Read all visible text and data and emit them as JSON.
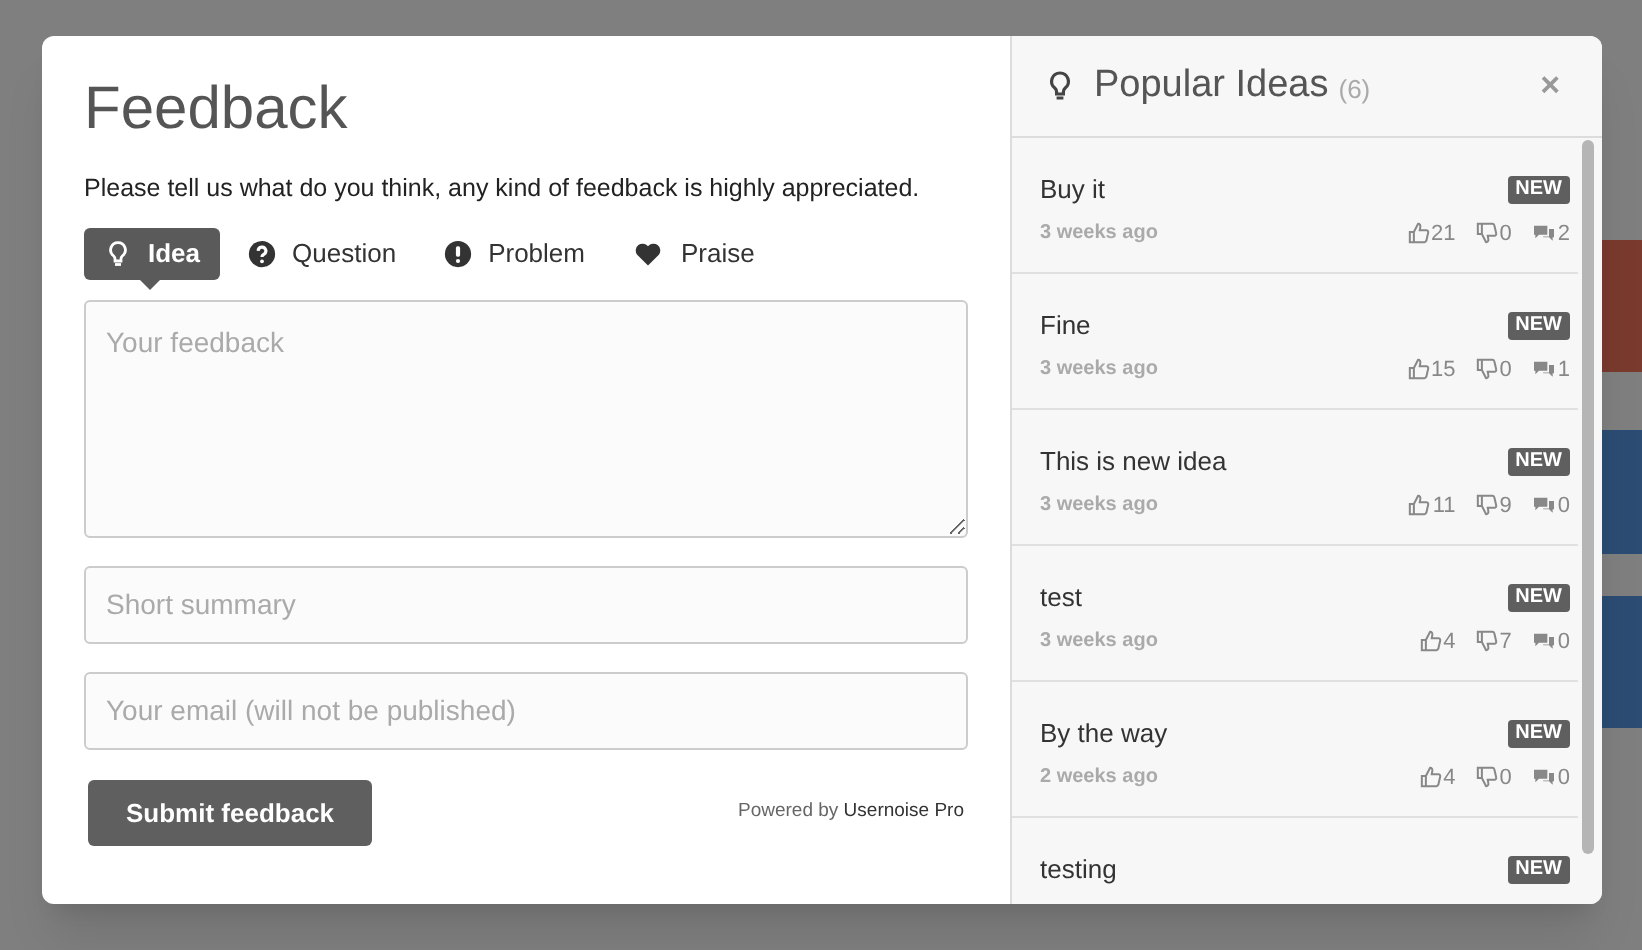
{
  "feedback": {
    "title": "Feedback",
    "intro": "Please tell us what do you think, any kind of feedback is highly appreciated.",
    "tabs": [
      {
        "label": "Idea",
        "selected": true
      },
      {
        "label": "Question",
        "selected": false
      },
      {
        "label": "Problem",
        "selected": false
      },
      {
        "label": "Praise",
        "selected": false
      }
    ],
    "feedback_field": {
      "placeholder": "Your feedback"
    },
    "summary_field": {
      "placeholder": "Short summary"
    },
    "email_field": {
      "placeholder": "Your email (will not be published)"
    },
    "submit": "Submit feedback",
    "powered_by": "Powered by",
    "powered_link": "Usernoise Pro"
  },
  "ideas": {
    "title": "Popular Ideas",
    "count": "(6)",
    "close": "×",
    "items": [
      {
        "title": "Buy it",
        "badge": "NEW",
        "time": "3 weeks ago",
        "likes": "21",
        "dislikes": "0",
        "comments": "2"
      },
      {
        "title": "Fine",
        "badge": "NEW",
        "time": "3 weeks ago",
        "likes": "15",
        "dislikes": "0",
        "comments": "1"
      },
      {
        "title": "This is new idea",
        "badge": "NEW",
        "time": "3 weeks ago",
        "likes": "11",
        "dislikes": "9",
        "comments": "0"
      },
      {
        "title": "test",
        "badge": "NEW",
        "time": "3 weeks ago",
        "likes": "4",
        "dislikes": "7",
        "comments": "0"
      },
      {
        "title": "By the way",
        "badge": "NEW",
        "time": "2 weeks ago",
        "likes": "4",
        "dislikes": "0",
        "comments": "0"
      },
      {
        "title": "testing",
        "badge": "NEW"
      }
    ]
  }
}
